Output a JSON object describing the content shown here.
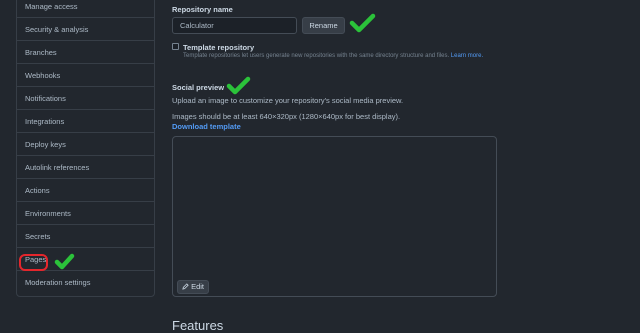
{
  "sidebar": {
    "items": [
      {
        "label": "Manage access"
      },
      {
        "label": "Security & analysis"
      },
      {
        "label": "Branches"
      },
      {
        "label": "Webhooks"
      },
      {
        "label": "Notifications"
      },
      {
        "label": "Integrations"
      },
      {
        "label": "Deploy keys"
      },
      {
        "label": "Autolink references"
      },
      {
        "label": "Actions"
      },
      {
        "label": "Environments"
      },
      {
        "label": "Secrets"
      },
      {
        "label": "Pages"
      },
      {
        "label": "Moderation settings"
      }
    ]
  },
  "repository": {
    "name_label": "Repository name",
    "name_value": "Calculator",
    "rename_label": "Rename",
    "template_label": "Template repository",
    "template_desc": "Template repositories let users generate new repositories with the same directory structure and files.",
    "template_learn_more": "Learn more."
  },
  "social_preview": {
    "heading": "Social preview",
    "desc": "Upload an image to customize your repository's social media preview.",
    "size_hint": "Images should be at least 640×320px (1280×640px for best display).",
    "download_label": "Download template",
    "edit_label": "Edit"
  },
  "features": {
    "heading": "Features"
  },
  "colors": {
    "checkmark": "#2bc23a",
    "highlight_ring": "#e5262c",
    "link": "#539bf5",
    "background": "#22272e"
  }
}
